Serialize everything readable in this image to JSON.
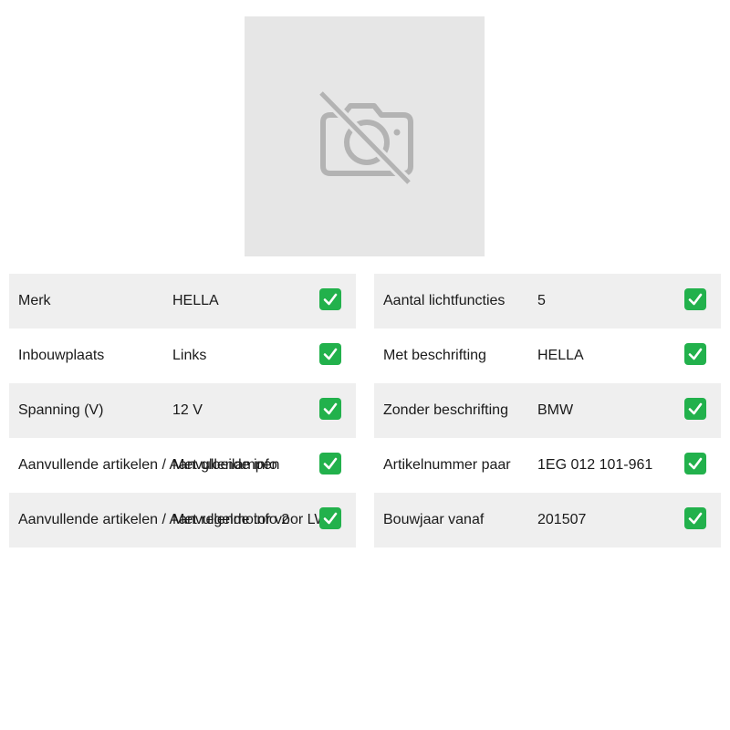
{
  "photo": {
    "icon": "camera-off-icon"
  },
  "left_table": {
    "rows": [
      {
        "label": "Merk",
        "value": "HELLA"
      },
      {
        "label": "Inbouwplaats",
        "value": "Links"
      },
      {
        "label": "Spanning (V)",
        "value": "12 V"
      },
      {
        "label": "Aanvullende artikelen / Aanvullende info",
        "value": "Met gloeilampen"
      },
      {
        "label": "Aanvullende artikelen / Aanvullende info 2",
        "value": "Met regelmotor voor LWR"
      }
    ]
  },
  "right_table": {
    "rows": [
      {
        "label": "Aantal lichtfuncties",
        "value": "5"
      },
      {
        "label": "Met beschrifting",
        "value": "HELLA"
      },
      {
        "label": "Zonder beschrifting",
        "value": "BMW"
      },
      {
        "label": "Artikelnummer paar",
        "value": "1EG 012 101-961"
      },
      {
        "label": "Bouwjaar vanaf",
        "value": "201507"
      }
    ]
  },
  "check_icon": "check-mark-icon",
  "colors": {
    "row_shade": "#efefef",
    "check_green": "#22b14c",
    "photo_bg": "#e6e6e6",
    "icon_gray": "#b3b3b3"
  }
}
